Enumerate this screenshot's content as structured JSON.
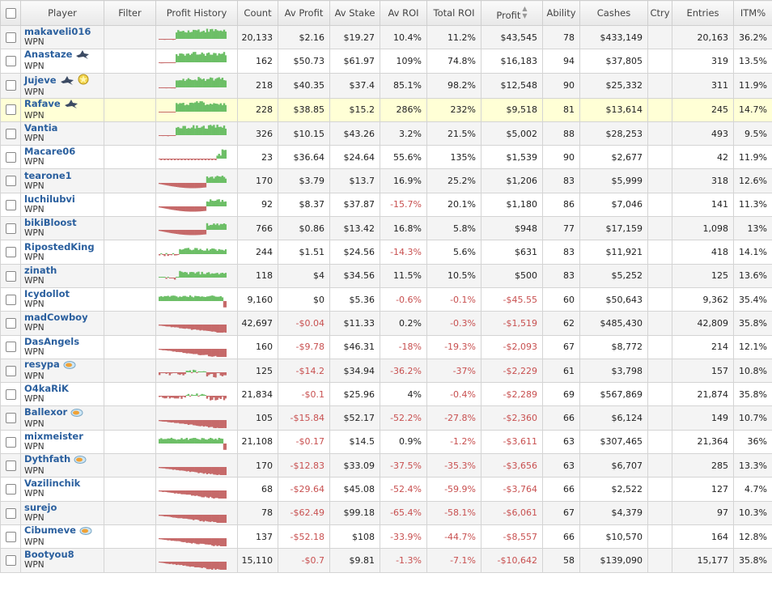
{
  "headers": {
    "player": "Player",
    "filter": "Filter",
    "profit_history": "Profit History",
    "count": "Count",
    "av_profit": "Av Profit",
    "av_stake": "Av Stake",
    "av_roi": "Av ROI",
    "total_roi": "Total ROI",
    "profit": "Profit",
    "ability": "Ability",
    "cashes": "Cashes",
    "ctry": "Ctry",
    "entries": "Entries",
    "itm": "ITM%"
  },
  "colors": {
    "positive": "#6dbf67",
    "negative": "#c66a6a",
    "highlight": "#ffffd6",
    "link": "#2a5f9e"
  },
  "rows": [
    {
      "player": "makaveli016",
      "network": "WPN",
      "badge": "",
      "count": "20,133",
      "av_profit": "$2.16",
      "av_stake": "$19.27",
      "av_roi": "10.4%",
      "total_roi": "11.2%",
      "profit": "$43,545",
      "ability": "78",
      "cashes": "$433,149",
      "ctry": "",
      "entries": "20,163",
      "itm": "36.2%",
      "trend": "pos"
    },
    {
      "player": "Anastaze",
      "network": "WPN",
      "badge": "shark-icon",
      "count": "162",
      "av_profit": "$50.73",
      "av_stake": "$61.97",
      "av_roi": "109%",
      "total_roi": "74.8%",
      "profit": "$16,183",
      "ability": "94",
      "cashes": "$37,805",
      "ctry": "",
      "entries": "319",
      "itm": "13.5%",
      "trend": "pos"
    },
    {
      "player": "Jujeve",
      "network": "WPN",
      "badge": "shark-icon",
      "badge2": "star-icon",
      "count": "218",
      "av_profit": "$40.35",
      "av_stake": "$37.4",
      "av_roi": "85.1%",
      "total_roi": "98.2%",
      "profit": "$12,548",
      "ability": "90",
      "cashes": "$25,332",
      "ctry": "",
      "entries": "311",
      "itm": "11.9%",
      "trend": "pos"
    },
    {
      "player": "Rafave",
      "network": "WPN",
      "badge": "shark-icon",
      "count": "228",
      "av_profit": "$38.85",
      "av_stake": "$15.2",
      "av_roi": "286%",
      "total_roi": "232%",
      "profit": "$9,518",
      "ability": "81",
      "cashes": "$13,614",
      "ctry": "",
      "entries": "245",
      "itm": "14.7%",
      "trend": "pos"
    },
    {
      "player": "Vantia",
      "network": "WPN",
      "badge": "",
      "count": "326",
      "av_profit": "$10.15",
      "av_stake": "$43.26",
      "av_roi": "3.2%",
      "total_roi": "21.5%",
      "profit": "$5,002",
      "ability": "88",
      "cashes": "$28,253",
      "ctry": "",
      "entries": "493",
      "itm": "9.5%",
      "trend": "pos"
    },
    {
      "player": "Macare06",
      "network": "WPN",
      "badge": "",
      "count": "23",
      "av_profit": "$36.64",
      "av_stake": "$24.64",
      "av_roi": "55.6%",
      "total_roi": "135%",
      "profit": "$1,539",
      "ability": "90",
      "cashes": "$2,677",
      "ctry": "",
      "entries": "42",
      "itm": "11.9%",
      "trend": "spiky"
    },
    {
      "player": "tearone1",
      "network": "WPN",
      "badge": "",
      "count": "170",
      "av_profit": "$3.79",
      "av_stake": "$13.7",
      "av_roi": "16.9%",
      "total_roi": "25.2%",
      "profit": "$1,206",
      "ability": "83",
      "cashes": "$5,999",
      "ctry": "",
      "entries": "318",
      "itm": "12.6%",
      "trend": "recover"
    },
    {
      "player": "luchilubvi",
      "network": "WPN",
      "badge": "",
      "count": "92",
      "av_profit": "$8.37",
      "av_stake": "$37.87",
      "av_roi": "-15.7%",
      "total_roi": "20.1%",
      "profit": "$1,180",
      "ability": "86",
      "cashes": "$7,046",
      "ctry": "",
      "entries": "141",
      "itm": "11.3%",
      "trend": "recover"
    },
    {
      "player": "bikiBloost",
      "network": "WPN",
      "badge": "",
      "count": "766",
      "av_profit": "$0.86",
      "av_stake": "$13.42",
      "av_roi": "16.8%",
      "total_roi": "5.8%",
      "profit": "$948",
      "ability": "77",
      "cashes": "$17,159",
      "ctry": "",
      "entries": "1,098",
      "itm": "13%",
      "trend": "recover"
    },
    {
      "player": "RipostedKing",
      "network": "WPN",
      "badge": "",
      "count": "244",
      "av_profit": "$1.51",
      "av_stake": "$24.56",
      "av_roi": "-14.3%",
      "total_roi": "5.6%",
      "profit": "$631",
      "ability": "83",
      "cashes": "$11,921",
      "ctry": "",
      "entries": "418",
      "itm": "14.1%",
      "trend": "mixedpos"
    },
    {
      "player": "zinath",
      "network": "WPN",
      "badge": "",
      "count": "118",
      "av_profit": "$4",
      "av_stake": "$34.56",
      "av_roi": "11.5%",
      "total_roi": "10.5%",
      "profit": "$500",
      "ability": "83",
      "cashes": "$5,252",
      "ctry": "",
      "entries": "125",
      "itm": "13.6%",
      "trend": "mixedpos"
    },
    {
      "player": "Icydollot",
      "network": "WPN",
      "badge": "",
      "count": "9,160",
      "av_profit": "$0",
      "av_stake": "$5.36",
      "av_roi": "-0.6%",
      "total_roi": "-0.1%",
      "profit": "-$45.55",
      "ability": "60",
      "cashes": "$50,643",
      "ctry": "",
      "entries": "9,362",
      "itm": "35.4%",
      "trend": "flatpos"
    },
    {
      "player": "madCowboy",
      "network": "WPN",
      "badge": "",
      "count": "42,697",
      "av_profit": "-$0.04",
      "av_stake": "$11.33",
      "av_roi": "0.2%",
      "total_roi": "-0.3%",
      "profit": "-$1,519",
      "ability": "62",
      "cashes": "$485,430",
      "ctry": "",
      "entries": "42,809",
      "itm": "35.8%",
      "trend": "neg"
    },
    {
      "player": "DasAngels",
      "network": "WPN",
      "badge": "",
      "count": "160",
      "av_profit": "-$9.78",
      "av_stake": "$46.31",
      "av_roi": "-18%",
      "total_roi": "-19.3%",
      "profit": "-$2,093",
      "ability": "67",
      "cashes": "$8,772",
      "ctry": "",
      "entries": "214",
      "itm": "12.1%",
      "trend": "neg"
    },
    {
      "player": "resypa",
      "network": "WPN",
      "badge": "fish-icon",
      "count": "125",
      "av_profit": "-$14.2",
      "av_stake": "$34.94",
      "av_roi": "-36.2%",
      "total_roi": "-37%",
      "profit": "-$2,229",
      "ability": "61",
      "cashes": "$3,798",
      "ctry": "",
      "entries": "157",
      "itm": "10.8%",
      "trend": "mixedneg"
    },
    {
      "player": "O4kaRiK",
      "network": "WPN",
      "badge": "",
      "count": "21,834",
      "av_profit": "-$0.1",
      "av_stake": "$25.96",
      "av_roi": "4%",
      "total_roi": "-0.4%",
      "profit": "-$2,289",
      "ability": "69",
      "cashes": "$567,869",
      "ctry": "",
      "entries": "21,874",
      "itm": "35.8%",
      "trend": "mixedneg"
    },
    {
      "player": "Ballexor",
      "network": "WPN",
      "badge": "fish-icon",
      "count": "105",
      "av_profit": "-$15.84",
      "av_stake": "$52.17",
      "av_roi": "-52.2%",
      "total_roi": "-27.8%",
      "profit": "-$2,360",
      "ability": "66",
      "cashes": "$6,124",
      "ctry": "",
      "entries": "149",
      "itm": "10.7%",
      "trend": "neg"
    },
    {
      "player": "mixmeister",
      "network": "WPN",
      "badge": "",
      "count": "21,108",
      "av_profit": "-$0.17",
      "av_stake": "$14.5",
      "av_roi": "0.9%",
      "total_roi": "-1.2%",
      "profit": "-$3,611",
      "ability": "63",
      "cashes": "$307,465",
      "ctry": "",
      "entries": "21,364",
      "itm": "36%",
      "trend": "flatpos"
    },
    {
      "player": "Dythfath",
      "network": "WPN",
      "badge": "fish-icon",
      "count": "170",
      "av_profit": "-$12.83",
      "av_stake": "$33.09",
      "av_roi": "-37.5%",
      "total_roi": "-35.3%",
      "profit": "-$3,656",
      "ability": "63",
      "cashes": "$6,707",
      "ctry": "",
      "entries": "285",
      "itm": "13.3%",
      "trend": "neg"
    },
    {
      "player": "Vazilinchik",
      "network": "WPN",
      "badge": "",
      "count": "68",
      "av_profit": "-$29.64",
      "av_stake": "$45.08",
      "av_roi": "-52.4%",
      "total_roi": "-59.9%",
      "profit": "-$3,764",
      "ability": "66",
      "cashes": "$2,522",
      "ctry": "",
      "entries": "127",
      "itm": "4.7%",
      "trend": "neg"
    },
    {
      "player": "surejo",
      "network": "WPN",
      "badge": "",
      "count": "78",
      "av_profit": "-$62.49",
      "av_stake": "$99.18",
      "av_roi": "-65.4%",
      "total_roi": "-58.1%",
      "profit": "-$6,061",
      "ability": "67",
      "cashes": "$4,379",
      "ctry": "",
      "entries": "97",
      "itm": "10.3%",
      "trend": "neg"
    },
    {
      "player": "Cibumeve",
      "network": "WPN",
      "badge": "fish-icon",
      "count": "137",
      "av_profit": "-$52.18",
      "av_stake": "$108",
      "av_roi": "-33.9%",
      "total_roi": "-44.7%",
      "profit": "-$8,557",
      "ability": "66",
      "cashes": "$10,570",
      "ctry": "",
      "entries": "164",
      "itm": "12.8%",
      "trend": "neg"
    },
    {
      "player": "Bootyou8",
      "network": "WPN",
      "badge": "",
      "count": "15,110",
      "av_profit": "-$0.7",
      "av_stake": "$9.81",
      "av_roi": "-1.3%",
      "total_roi": "-7.1%",
      "profit": "-$10,642",
      "ability": "58",
      "cashes": "$139,090",
      "ctry": "",
      "entries": "15,177",
      "itm": "35.8%",
      "trend": "neg"
    }
  ]
}
